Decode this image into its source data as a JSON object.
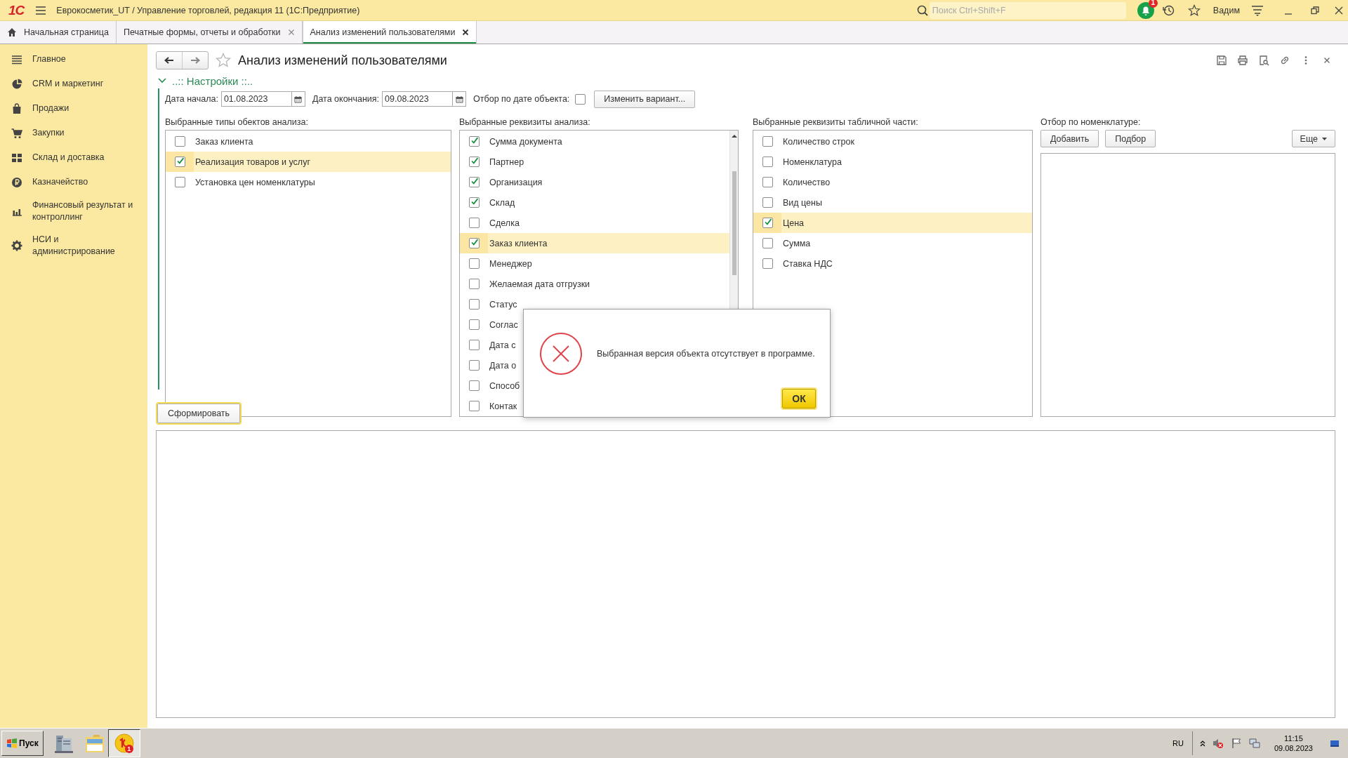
{
  "window": {
    "logo": "1С",
    "title": "Еврокосметик_UT / Управление торговлей, редакция 11  (1С:Предприятие)",
    "search": {
      "placeholder": "Поиск Ctrl+Shift+F"
    },
    "notification_badge": "1",
    "user": "Вадим"
  },
  "tabs": [
    {
      "label": "Начальная страница",
      "selected": false,
      "closable": false
    },
    {
      "label": "Печатные формы, отчеты и обработки",
      "selected": false,
      "closable": true
    },
    {
      "label": "Анализ изменений пользователями",
      "selected": true,
      "closable": true
    }
  ],
  "sidebar": {
    "items": [
      {
        "label": "Главное"
      },
      {
        "label": "CRM и маркетинг"
      },
      {
        "label": "Продажи"
      },
      {
        "label": "Закупки"
      },
      {
        "label": "Склад и доставка"
      },
      {
        "label": "Казначейство"
      },
      {
        "label": "Финансовый результат и контроллинг"
      },
      {
        "label": "НСИ и администрирование"
      }
    ]
  },
  "form": {
    "title": "Анализ изменений пользователями",
    "settings": {
      "label": "..:: Настройки ::..",
      "expanded": true
    },
    "start_date": {
      "label": "Дата начала:",
      "value": "01.08.2023"
    },
    "end_date": {
      "label": "Дата окончания:",
      "value": "09.08.2023"
    },
    "filter_by_date": {
      "label": "Отбор по дате объекта:",
      "checked": false
    },
    "change_variant_button": "Изменить вариант...",
    "lists": [
      {
        "label": "Выбранные типы обектов анализа:",
        "scrollbar": false,
        "items": [
          {
            "label": "Заказ клиента",
            "checked": false,
            "selected": false
          },
          {
            "label": "Реализация товаров и услуг",
            "checked": true,
            "selected": true
          },
          {
            "label": "Установка цен номенклатуры",
            "checked": false,
            "selected": false
          }
        ]
      },
      {
        "label": "Выбранные реквизиты анализа:",
        "scrollbar": true,
        "items": [
          {
            "label": "Сумма документа",
            "checked": true,
            "selected": false
          },
          {
            "label": "Партнер",
            "checked": true,
            "selected": false
          },
          {
            "label": "Организация",
            "checked": true,
            "selected": false
          },
          {
            "label": "Склад",
            "checked": true,
            "selected": false
          },
          {
            "label": "Сделка",
            "checked": false,
            "selected": false
          },
          {
            "label": "Заказ клиента",
            "checked": true,
            "selected": true
          },
          {
            "label": "Менеджер",
            "checked": false,
            "selected": false
          },
          {
            "label": "Желаемая дата отгрузки",
            "checked": false,
            "selected": false
          },
          {
            "label": "Статус",
            "checked": false,
            "selected": false
          },
          {
            "label": "Соглас",
            "checked": false,
            "selected": false
          },
          {
            "label": "Дата с",
            "checked": false,
            "selected": false
          },
          {
            "label": "Дата о",
            "checked": false,
            "selected": false
          },
          {
            "label": "Способ",
            "checked": false,
            "selected": false
          },
          {
            "label": "Контак",
            "checked": false,
            "selected": false
          }
        ]
      },
      {
        "label": "Выбранные реквизиты табличной части:",
        "scrollbar": false,
        "items": [
          {
            "label": "Количество строк",
            "checked": false,
            "selected": false
          },
          {
            "label": "Номенклатура",
            "checked": false,
            "selected": false
          },
          {
            "label": "Количество",
            "checked": false,
            "selected": false
          },
          {
            "label": "Вид цены",
            "checked": false,
            "selected": false
          },
          {
            "label": "Цена",
            "checked": true,
            "selected": true
          },
          {
            "label": "Сумма",
            "checked": false,
            "selected": false
          },
          {
            "label": "Ставка НДС",
            "checked": false,
            "selected": false
          }
        ]
      }
    ],
    "nomenclature_filter": {
      "label": "Отбор по номенклатуре:",
      "buttons": [
        "Добавить",
        "Подбор"
      ],
      "more_button": "Еще"
    },
    "generate_button": "Сформировать"
  },
  "dialog": {
    "message": "Выбранная версия объекта отсутствует в программе.",
    "button": "ОК"
  },
  "taskbar": {
    "start": "Пуск",
    "app_badge": "1",
    "language": "RU",
    "time": "11:15",
    "date": "09.08.2023"
  }
}
